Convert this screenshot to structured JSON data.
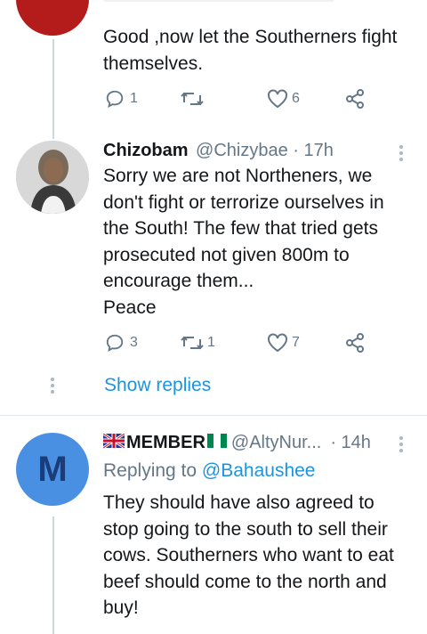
{
  "tweet1": {
    "text_line1": "Good ,now let the Southerners fight",
    "text_line2": "themselves.",
    "reply_count": "1",
    "retweet_count": "",
    "like_count": "6"
  },
  "tweet2": {
    "display_name": "Chizobam",
    "handle_time": "@Chizybae · 17h",
    "lines": [
      "Sorry we are not Northeners, we",
      "don't fight or terrorize ourselves in",
      "the South! The few that tried gets",
      "prosecuted not given 800m to",
      "encourage them...",
      "Peace"
    ],
    "reply_count": "3",
    "retweet_count": "1",
    "like_count": "7",
    "show_replies": "Show replies"
  },
  "tweet3": {
    "avatar_letter": "M",
    "display_name": "MEMBER",
    "handle": "@AltyNur...",
    "time": "· 14h",
    "replying_to_label": "Replying to",
    "replying_to_handle": "@Bahaushee",
    "lines": [
      "They should have also agreed to",
      "stop going to the south to sell their",
      "cows. Southerners who want to eat",
      "beef should come to the north and",
      "buy!"
    ]
  },
  "colors": {
    "accent": "#1b95e0",
    "muted": "#657786",
    "avatar_red": "#b41b1b",
    "avatar_blue": "#4a90e2"
  }
}
